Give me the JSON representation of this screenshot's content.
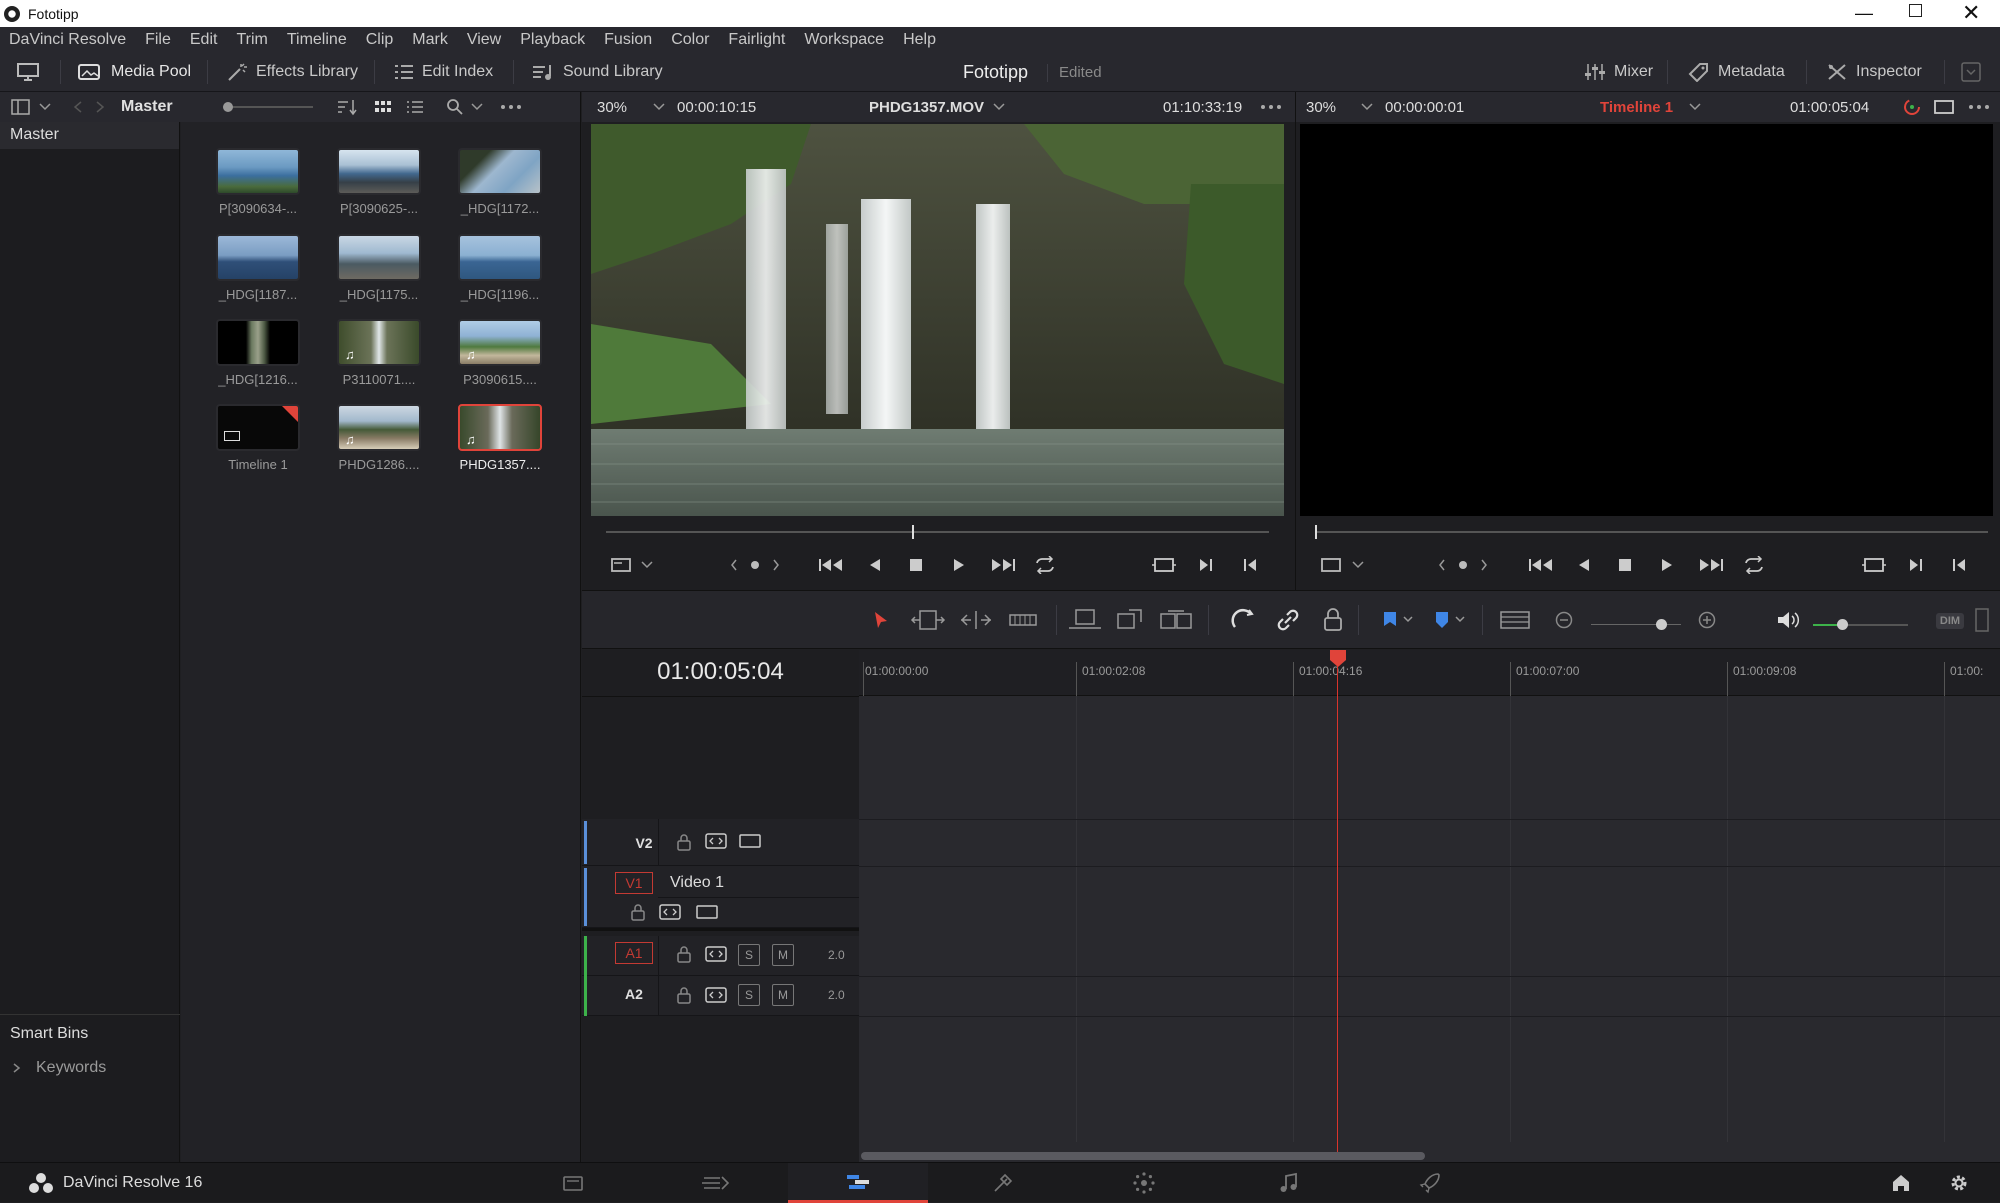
{
  "window": {
    "title": "Fototipp"
  },
  "menu": [
    "DaVinci Resolve",
    "File",
    "Edit",
    "Trim",
    "Timeline",
    "Clip",
    "Mark",
    "View",
    "Playback",
    "Fusion",
    "Color",
    "Fairlight",
    "Workspace",
    "Help"
  ],
  "toolbar": {
    "media_pool": "Media Pool",
    "effects_library": "Effects Library",
    "edit_index": "Edit Index",
    "sound_library": "Sound Library",
    "project_name": "Fototipp",
    "project_status": "Edited",
    "mixer": "Mixer",
    "metadata": "Metadata",
    "inspector": "Inspector"
  },
  "media_pool": {
    "bin_title": "Master",
    "bins": [
      "Master"
    ],
    "smart_bins": {
      "title": "Smart Bins",
      "items": [
        "Keywords"
      ]
    },
    "clips": [
      {
        "label": "P[3090634-...",
        "icon": "image"
      },
      {
        "label": "P[3090625-...",
        "icon": "image"
      },
      {
        "label": "_HDG[1172...",
        "icon": "image"
      },
      {
        "label": "_HDG[1187...",
        "icon": "image"
      },
      {
        "label": "_HDG[1175...",
        "icon": "image"
      },
      {
        "label": "_HDG[1196...",
        "icon": "image"
      },
      {
        "label": "_HDG[1216...",
        "icon": "image"
      },
      {
        "label": "P3110071....",
        "icon": "music-note"
      },
      {
        "label": "P3090615....",
        "icon": "music-note"
      },
      {
        "label": "Timeline 1",
        "icon": "timeline"
      },
      {
        "label": "PHDG1286....",
        "icon": "music-note"
      },
      {
        "label": "PHDG1357....",
        "icon": "music-note",
        "selected": true
      }
    ]
  },
  "source_viewer": {
    "zoom": "30%",
    "duration": "00:00:10:15",
    "clip_name": "PHDG1357.MOV",
    "timecode": "01:10:33:19"
  },
  "timeline_viewer": {
    "zoom": "30%",
    "duration": "00:00:00:01",
    "timeline_name": "Timeline 1",
    "timecode": "01:00:05:04"
  },
  "timeline": {
    "current_timecode": "01:00:05:04",
    "ruler": [
      "01:00:00:00",
      "01:00:02:08",
      "01:00:04:16",
      "01:00:07:00",
      "01:00:09:08",
      "01:00:"
    ],
    "tracks": [
      {
        "id": "V2",
        "name": "",
        "kind": "video"
      },
      {
        "id": "V1",
        "name": "Video 1",
        "kind": "video"
      },
      {
        "id": "A1",
        "name": "",
        "kind": "audio",
        "level": "2.0",
        "solo": "S",
        "mute": "M"
      },
      {
        "id": "A2",
        "name": "",
        "kind": "audio",
        "level": "2.0",
        "solo": "S",
        "mute": "M"
      }
    ],
    "dim_label": "DIM"
  },
  "footer": {
    "app_name": "DaVinci Resolve 16"
  },
  "colors": {
    "accent_red": "#e0443a",
    "panel": "#28282e",
    "background": "#1f1f22",
    "audio_green": "#3db24a",
    "video_blue": "#5a8fd8"
  }
}
